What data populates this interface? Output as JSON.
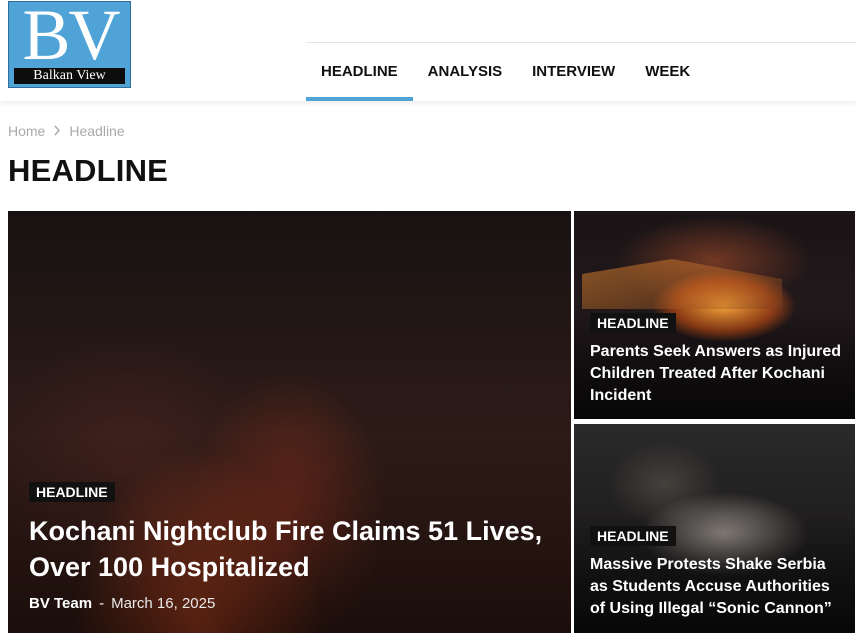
{
  "logo": {
    "mark": "BV",
    "name": "Balkan View"
  },
  "nav": {
    "items": [
      {
        "label": "HEADLINE",
        "active": true
      },
      {
        "label": "ANALYSIS",
        "active": false
      },
      {
        "label": "INTERVIEW",
        "active": false
      },
      {
        "label": "WEEK",
        "active": false
      }
    ]
  },
  "breadcrumb": {
    "home": "Home",
    "current": "Headline"
  },
  "page_title": "HEADLINE",
  "featured": {
    "badge": "HEADLINE",
    "title": "Kochani Nightclub Fire Claims 51 Lives, Over 100 Hospitalized",
    "author": "BV Team",
    "separator": "-",
    "date": "March 16, 2025"
  },
  "side_articles": [
    {
      "badge": "HEADLINE",
      "title": "Parents Seek Answers as Injured Children Treated After Kochani Incident"
    },
    {
      "badge": "HEADLINE",
      "title": "Massive Protests Shake Serbia as Students Accuse Authorities of Using Illegal “Sonic Cannon”"
    }
  ],
  "colors": {
    "accent": "#4fa3d6",
    "badge_bg": "#111111",
    "logo_bg": "#4fa3d6"
  }
}
